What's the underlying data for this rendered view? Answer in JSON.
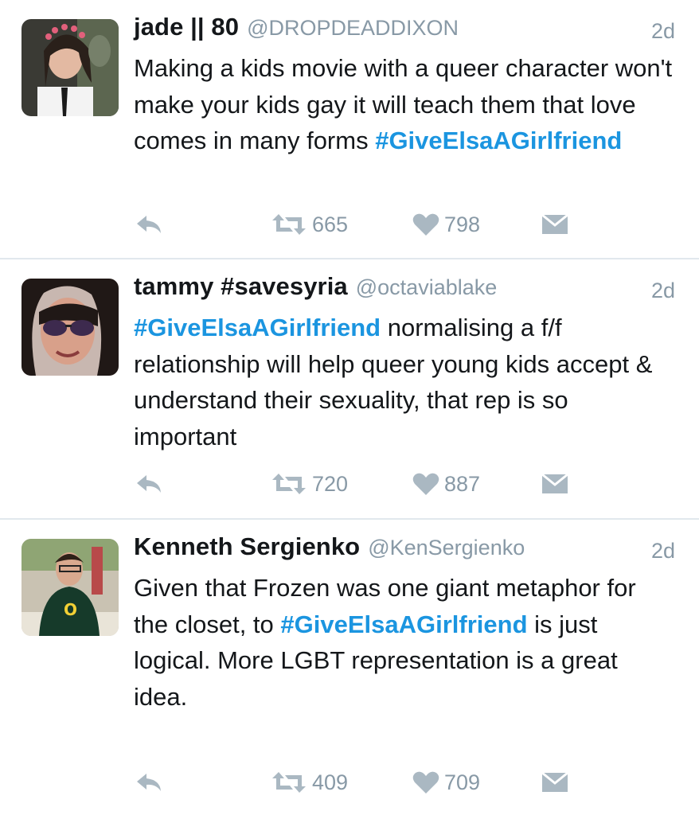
{
  "colors": {
    "link": "#1b95e0",
    "secondary_text": "#8899a6",
    "icon": "#aab8c2",
    "divider": "#e1e8ed"
  },
  "tweets": [
    {
      "display_name": "jade || 80",
      "handle": "@DROPDEADDIXON",
      "time": "2d",
      "text_parts": [
        "Making a kids movie with a queer character won't make your kids gay it will teach them that love comes in many forms ",
        "#GiveElsaAGirlfriend"
      ],
      "retweets": "665",
      "likes": "798"
    },
    {
      "display_name": "tammy #savesyria",
      "handle": "@octaviablake",
      "time": "2d",
      "text_parts": [
        "#GiveElsaAGirlfriend",
        " normalising a f/f relationship will help queer young kids accept & understand their sexuality, that rep is so important"
      ],
      "retweets": "720",
      "likes": "887"
    },
    {
      "display_name": "Kenneth Sergienko",
      "handle": "@KenSergienko",
      "time": "2d",
      "text_parts": [
        "Given that Frozen was one giant metaphor for the closet, to ",
        "#GiveElsaAGirlfriend",
        " is just logical. More LGBT representation is a great idea."
      ],
      "retweets": "409",
      "likes": "709"
    }
  ],
  "icons": {
    "reply": "reply-icon",
    "retweet": "retweet-icon",
    "like": "heart-icon",
    "dm": "envelope-icon"
  }
}
